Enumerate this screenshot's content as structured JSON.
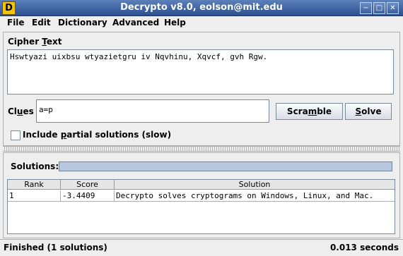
{
  "window": {
    "title": "Decrypto v8.0, eolson@mit.edu",
    "app_icon_letter": "D",
    "controls": [
      "minimize-icon",
      "maximize-icon",
      "close-icon"
    ]
  },
  "menu": {
    "items": [
      "File",
      "Edit",
      "Dictionary",
      "Advanced",
      "Help"
    ]
  },
  "cipher": {
    "label_pre": "Cipher ",
    "label_u": "T",
    "label_post": "ext",
    "value": "Hswtyazi uixbsu wtyazietgru iv Nqvhinu, Xqvcf, gvh Rgw."
  },
  "clues": {
    "label_pre": "Cl",
    "label_u": "u",
    "label_post": "es",
    "value": "a=p"
  },
  "buttons": {
    "scramble_pre": "Scra",
    "scramble_u": "m",
    "scramble_post": "ble",
    "solve_u": "S",
    "solve_post": "olve"
  },
  "partial": {
    "label_pre": "Include ",
    "label_u": "p",
    "label_post": "artial solutions (slow)",
    "checked": false
  },
  "solutions": {
    "label": "Solutions:",
    "progress": 1.0,
    "columns": [
      "Rank",
      "Score",
      "Solution"
    ],
    "rows": [
      {
        "rank": "1",
        "score": "-3.4409",
        "solution": "Decrypto solves cryptograms on Windows, Linux, and Mac."
      }
    ]
  },
  "status": {
    "left": "Finished (1 solutions)",
    "right": "0.013 seconds"
  }
}
